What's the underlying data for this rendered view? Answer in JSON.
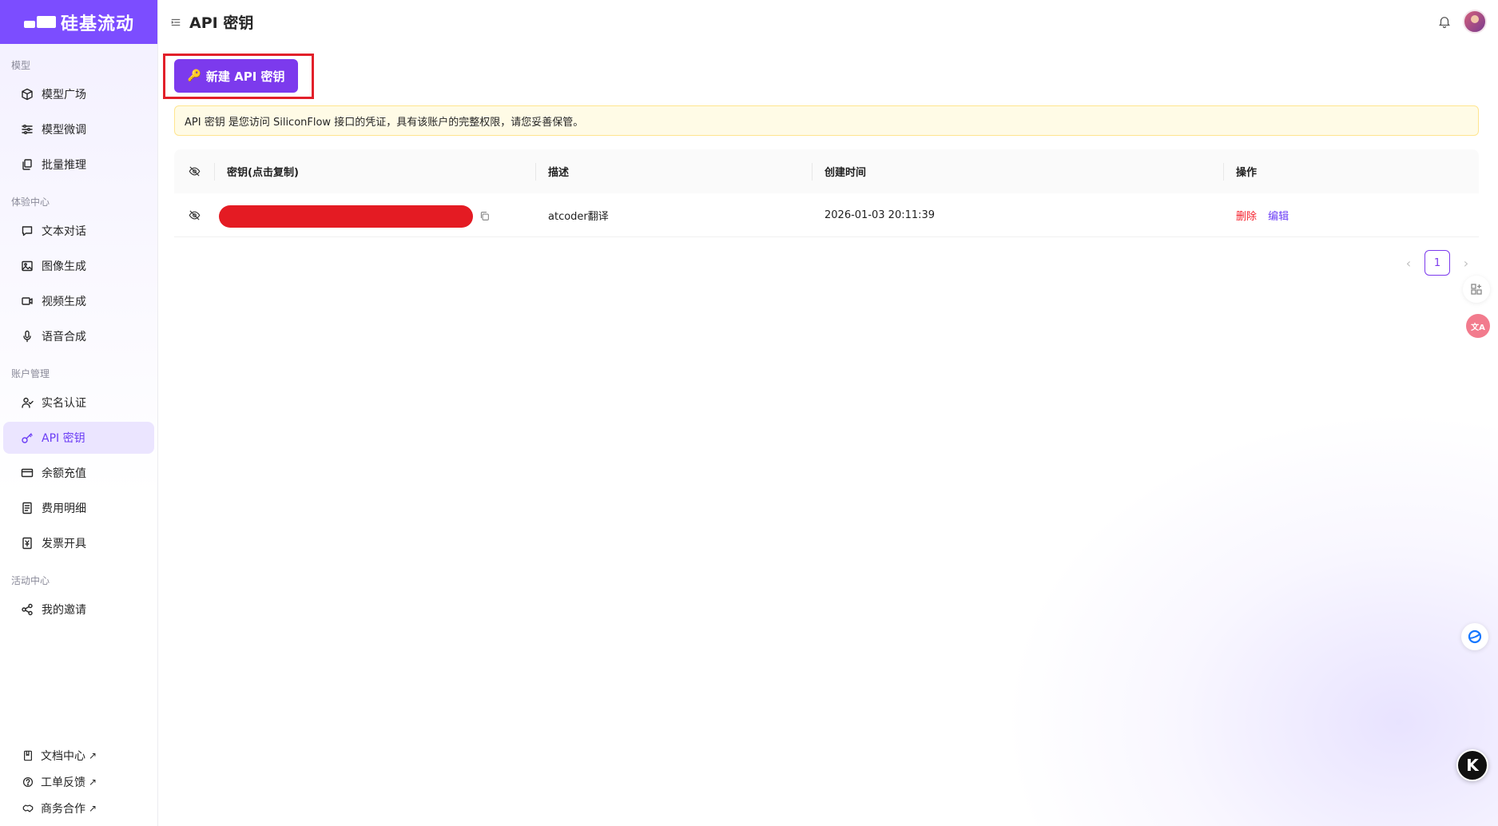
{
  "brand": {
    "name": "硅基流动",
    "color": "#7c4dff"
  },
  "header": {
    "title": "API 密钥"
  },
  "sidebar": {
    "sections": [
      {
        "title": "模型",
        "items": [
          {
            "label": "模型广场",
            "icon": "cube-icon"
          },
          {
            "label": "模型微调",
            "icon": "sliders-icon"
          },
          {
            "label": "批量推理",
            "icon": "layers-icon"
          }
        ]
      },
      {
        "title": "体验中心",
        "items": [
          {
            "label": "文本对话",
            "icon": "chat-icon"
          },
          {
            "label": "图像生成",
            "icon": "image-icon"
          },
          {
            "label": "视频生成",
            "icon": "video-icon"
          },
          {
            "label": "语音合成",
            "icon": "mic-icon"
          }
        ]
      },
      {
        "title": "账户管理",
        "items": [
          {
            "label": "实名认证",
            "icon": "user-check-icon"
          },
          {
            "label": "API 密钥",
            "icon": "key-icon",
            "active": true
          },
          {
            "label": "余额充值",
            "icon": "card-icon"
          },
          {
            "label": "费用明细",
            "icon": "receipt-icon"
          },
          {
            "label": "发票开具",
            "icon": "invoice-icon"
          }
        ]
      },
      {
        "title": "活动中心",
        "items": [
          {
            "label": "我的邀请",
            "icon": "share-icon"
          }
        ]
      }
    ],
    "footer": [
      {
        "label": "文档中心",
        "icon": "book-icon"
      },
      {
        "label": "工单反馈",
        "icon": "help-icon"
      },
      {
        "label": "商务合作",
        "icon": "handshake-icon"
      }
    ]
  },
  "main": {
    "new_button_label": "新建 API 密钥",
    "notice": "API 密钥 是您访问 SiliconFlow 接口的凭证，具有该账户的完整权限，请您妥善保管。",
    "table": {
      "columns": [
        "密钥(点击复制)",
        "描述",
        "创建时间",
        "操作"
      ],
      "rows": [
        {
          "description": "atcoder翻译",
          "created": "2026-01-03 20:11:39",
          "delete_label": "删除",
          "edit_label": "编辑"
        }
      ]
    },
    "pagination": {
      "current": "1"
    }
  },
  "floating": {
    "translate_label": "文A",
    "k_label": "K"
  }
}
